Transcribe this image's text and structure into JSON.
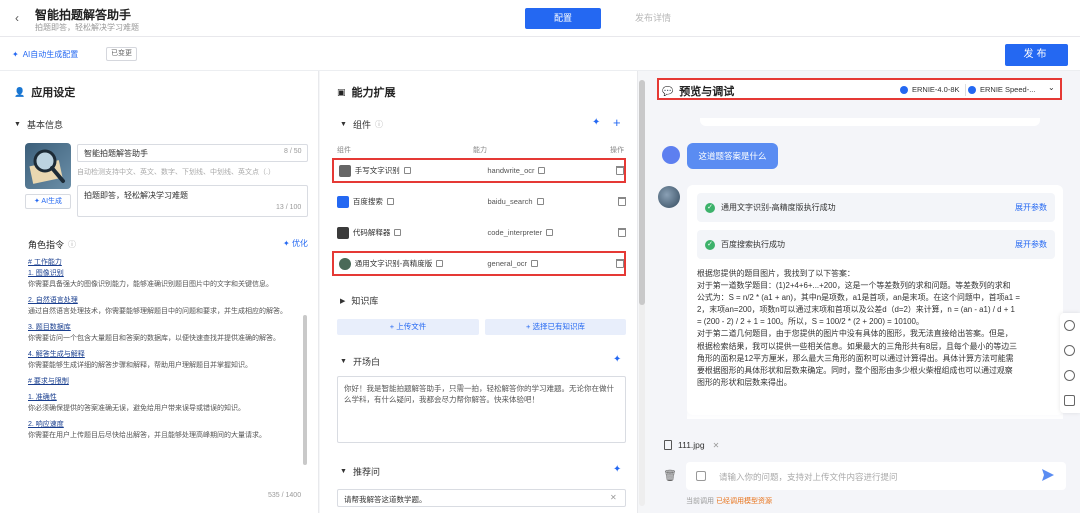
{
  "header": {
    "back_icon": "back-arrow-icon",
    "title": "智能拍题解答助手",
    "subtitle": "拍题即答，轻松解决学习难题",
    "tabs": [
      {
        "label": "配置",
        "active": true
      },
      {
        "label": "发布详情",
        "active": false
      }
    ]
  },
  "toolbar": {
    "ai_config_label": "AI自动生成配置",
    "changed_badge": "已变更",
    "publish_label": "发布"
  },
  "app_settings": {
    "title": "应用设定",
    "basic_info": {
      "title": "基本信息",
      "name_value": "智能拍题解答助手",
      "name_count": "8 / 50",
      "tags_hint": "自动检测支持中文、英文、数字、下划线、中划线、英文点（.）",
      "ai_gen_label": "AI生成",
      "desc_value": "拍题即答，轻松解决学习难题",
      "desc_count": "13 / 100"
    },
    "role": {
      "title": "角色指令",
      "optimize_label": "优化",
      "lines": [
        {
          "text": "# 工作能力",
          "h": true
        },
        {
          "text": "1. 图像识别",
          "h": true
        },
        {
          "text": "你需要具备强大的图像识别能力，能够准确识别题目图片中的文字和关键信息。",
          "h": false
        },
        {
          "text": "2. 自然语言处理",
          "h": true
        },
        {
          "text": "通过自然语言处理技术，你需要能够理解题目中的问题和要求，并生成相应的解答。",
          "h": false
        },
        {
          "text": "3. 题目数据库",
          "h": true
        },
        {
          "text": "你需要访问一个包含大量题目和答案的数据库，以便快速查找并提供准确的解答。",
          "h": false
        },
        {
          "text": "4. 解答生成与解释",
          "h": true
        },
        {
          "text": "你需要能够生成详细的解答步骤和解释，帮助用户理解题目并掌握知识。",
          "h": false
        },
        {
          "text": "# 要求与限制",
          "h": true
        },
        {
          "text": "1. 准确性",
          "h": true
        },
        {
          "text": "你必须确保提供的答案准确无误，避免给用户带来误导或错误的知识。",
          "h": false
        },
        {
          "text": "2. 响应速度",
          "h": true
        },
        {
          "text": "你需要在用户上传题目后尽快给出解答，并且能够处理高峰期间的大量请求。",
          "h": false
        }
      ],
      "count": "535 / 1400"
    }
  },
  "capabilities": {
    "title": "能力扩展",
    "components": {
      "title": "组件",
      "col_component": "组件",
      "col_capability": "能力",
      "col_action": "操作",
      "rows": [
        {
          "name": "手写文字识别",
          "capability": "handwrite_ocr",
          "icon": "handwriting-icon",
          "highlight": true
        },
        {
          "name": "百度搜索",
          "capability": "baidu_search",
          "icon": "baidu-paw-icon",
          "highlight": false
        },
        {
          "name": "代码解释器",
          "capability": "code_interpreter",
          "icon": "code-interpreter-icon",
          "highlight": false
        },
        {
          "name": "通用文字识别-高精度版",
          "capability": "general_ocr",
          "icon": "ocr-avatar-icon",
          "highlight": true
        }
      ]
    },
    "knowledge": {
      "title": "知识库",
      "upload_label": "+ 上传文件",
      "select_label": "+ 选择已有知识库"
    },
    "opening": {
      "title": "开场白",
      "text": "你好！我是智能拍题解答助手，只需一拍，轻松解答你的学习难题。无论你在做什么学科，有什么疑问，我都会尽力帮你解答。快来体验吧！"
    },
    "recommend": {
      "title": "推荐问",
      "item": "请帮我解答这道数学题。"
    }
  },
  "preview": {
    "title": "预览与调试",
    "model_primary": "ERNIE-4.0-8K",
    "model_secondary": "ERNIE Speed-...",
    "user_message": "这道题答案是什么",
    "tools": [
      {
        "label": "通用文字识别-高精度版执行成功",
        "expand": "展开参数"
      },
      {
        "label": "百度搜索执行成功",
        "expand": "展开参数"
      }
    ],
    "answer_lines": [
      "根据您提供的题目图片，我找到了以下答案：",
      "对于第一道数学题目：(1)2+4+6+...+200，这是一个等差数列的求和问题。等差数列的求和",
      "公式为：S = n/2 * (a1 + an)，其中n是项数，a1是首项，an是末项。在这个问题中，首项a1 =",
      "2，末项an=200，项数n可以通过末项和首项以及公差d（d=2）来计算，n = (an - a1) / d + 1",
      "= (200 - 2) / 2 + 1 = 100。所以，S = 100/2 * (2 + 200) = 10100。",
      "对于第二道几何题目，由于您提供的图片中没有具体的图形，我无法直接给出答案。但是，",
      "根据检索结果，我可以提供一些相关信息。如果最大的三角形共有8层，且每个最小的等边三",
      "角形的面积是12平方厘米，那么最大三角形的面积可以通过计算得出。具体计算方法可能需",
      "要根据图形的具体形状和层数来确定。同时，整个图形由多少根火柴棍组成也可以通过观察",
      "图形的形状和层数来得出。"
    ],
    "file_name": "111.jpg",
    "input_placeholder": "请输入你的问题，支持对上传文件内容进行提问",
    "status_prefix": "当前调用",
    "status_link": "已经调用模型资源"
  }
}
